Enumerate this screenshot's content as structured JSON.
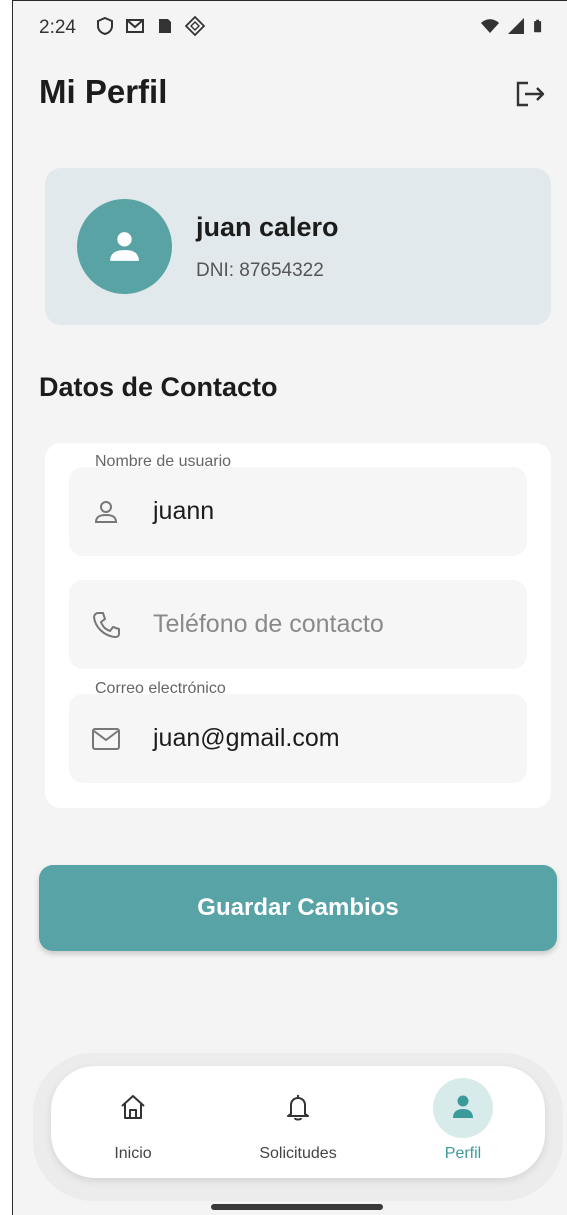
{
  "status_bar": {
    "time": "2:24",
    "icons": [
      "shield-icon",
      "gmail-icon",
      "sim-card-icon",
      "app-notification-icon"
    ],
    "right_icons": [
      "wifi-icon",
      "signal-icon",
      "battery-icon"
    ]
  },
  "header": {
    "title": "Mi Perfil",
    "logout_icon": "logout-icon"
  },
  "profile": {
    "name": "juan calero",
    "dni": "DNI: 87654322",
    "avatar_icon": "person-icon",
    "avatar_color": "#5aa3a4"
  },
  "contact": {
    "section_title": "Datos de Contacto",
    "username": {
      "label": "Nombre de usuario",
      "value": "juann",
      "icon": "person-outline-icon"
    },
    "phone": {
      "placeholder": "Teléfono de contacto",
      "value": "",
      "icon": "phone-icon"
    },
    "email": {
      "label": "Correo electrónico",
      "value": "juan@gmail.com",
      "icon": "mail-icon"
    }
  },
  "save_button": {
    "label": "Guardar Cambios",
    "color": "#57a3a6"
  },
  "bottom_nav": {
    "items": [
      {
        "label": "Inicio",
        "icon": "home-icon",
        "active": false
      },
      {
        "label": "Solicitudes",
        "icon": "bell-icon",
        "active": false
      },
      {
        "label": "Perfil",
        "icon": "person-icon",
        "active": true
      }
    ],
    "active_color": "#3c9a9b"
  }
}
